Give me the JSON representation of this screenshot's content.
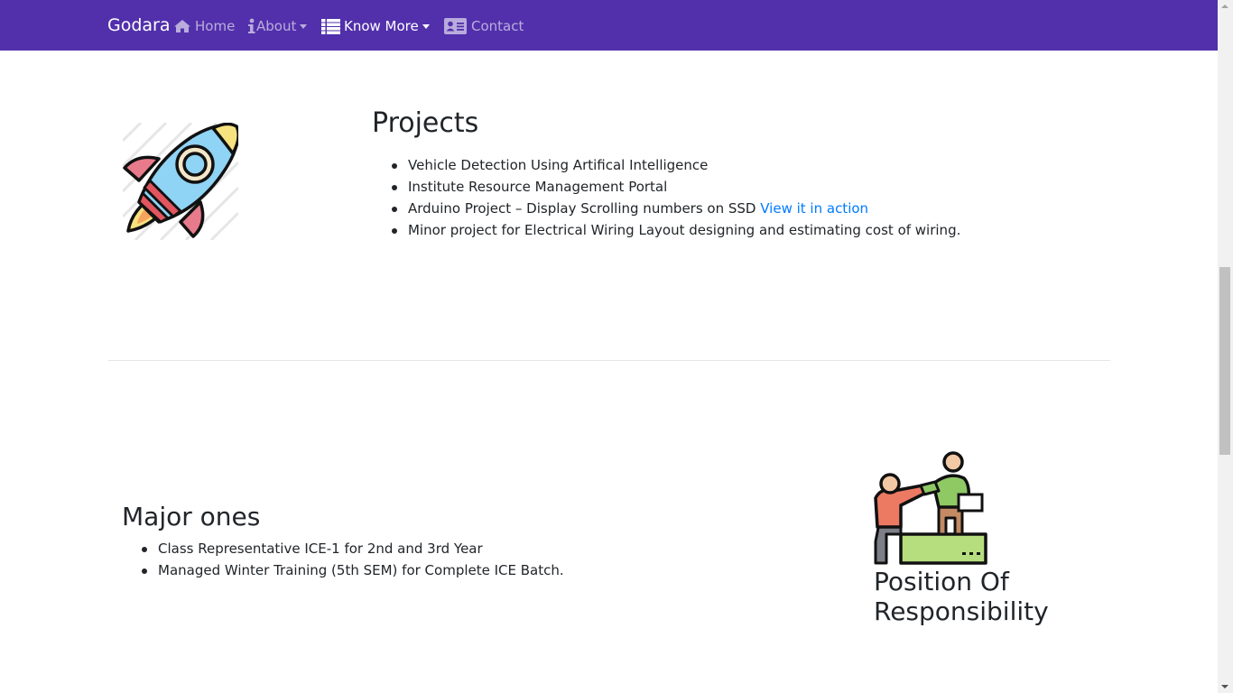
{
  "navbar": {
    "brand": "Godara",
    "items": [
      {
        "label": "Home",
        "icon": "home-icon"
      },
      {
        "label": "About",
        "icon": "info-icon"
      },
      {
        "label": "Know More",
        "icon": "list-icon"
      },
      {
        "label": "Contact",
        "icon": "address-card-icon"
      }
    ],
    "background": "#5230ab"
  },
  "projects": {
    "title": "Projects",
    "items": [
      "Vehicle Detection Using Artifical Intelligence",
      "Institute Resource Management Portal",
      "Arduino Project – Display Scrolling numbers on SSD ",
      "Minor project for Electrical Wiring Layout designing and estimating cost of wiring."
    ],
    "link_label": "View it in action",
    "icon": "rocket-icon"
  },
  "responsibility": {
    "section_title": "Major ones",
    "items": [
      "Class Representative ICE-1 for 2nd and 3rd Year",
      "Managed Winter Training (5th SEM) for Complete ICE Batch."
    ],
    "heading": "Position Of Responsibility",
    "icon": "helping-hand-icon"
  },
  "colors": {
    "link": "#007bff",
    "text": "#212529"
  }
}
